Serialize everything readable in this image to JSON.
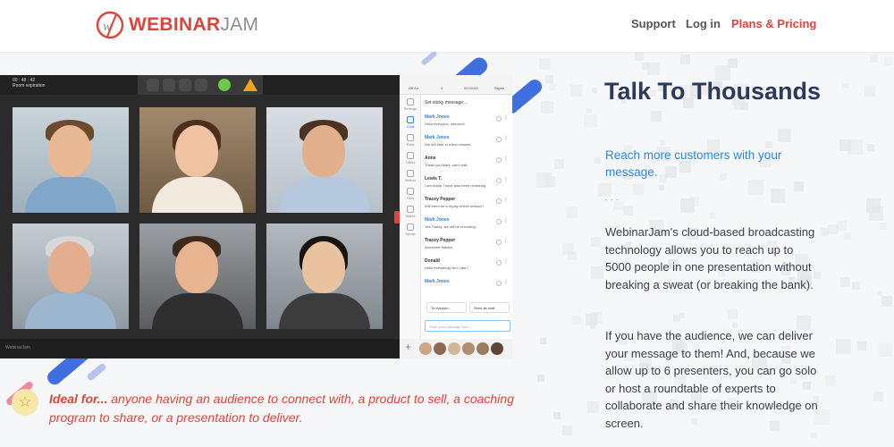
{
  "header": {
    "logo": {
      "text_red": "WEBINAR",
      "text_gray": "JAM",
      "icon": "webinarjam-logo-icon"
    },
    "nav": [
      {
        "label": "Support"
      },
      {
        "label": "Log in"
      },
      {
        "label": "Plans & Pricing"
      }
    ]
  },
  "app": {
    "timer": "00 : 48 : 42",
    "timer_sub": "Room expiration",
    "brand": "WebinarJam",
    "chat_top": [
      "Off Air",
      "0",
      "00:00:00",
      "Signal"
    ],
    "sidebar": [
      "Settings",
      "Chat",
      "Polls",
      "Offers",
      "Videos",
      "Files",
      "Slides",
      "Speak"
    ],
    "sticky": "Set sticky message...",
    "messages": [
      {
        "name": "Mark Jones",
        "text": "Hello everyone, welcome",
        "highlight": true
      },
      {
        "name": "Mark Jones",
        "text": "We will start in a few minutes",
        "highlight": true
      },
      {
        "name": "Anne",
        "text": "Thank you Mark, can't wait",
        "highlight": false
      },
      {
        "name": "Lewis T.",
        "text": "I am ready. I have also been reviewing",
        "highlight": false
      },
      {
        "name": "Tracey Pepper",
        "text": "Will there be a replay of this session?",
        "highlight": false
      },
      {
        "name": "Mark Jones",
        "text": "Yes Tracey, we will be recording",
        "highlight": true
      },
      {
        "name": "Tracey Pepper",
        "text": "Awesome thanks!",
        "highlight": false
      },
      {
        "name": "Donald",
        "text": "Hello everybody! Am I late?",
        "highlight": false
      },
      {
        "name": "Mark Jones",
        "text": "",
        "highlight": true
      }
    ],
    "to_everybody": "To everybo...",
    "send_as_chat": "Send as chat",
    "input_placeholder": "Write your message here..."
  },
  "ideal": {
    "lead": "Ideal for...",
    "text": " anyone having an audience to connect with, a product to sell, a coaching program to share, or a presentation to deliver."
  },
  "copy": {
    "title": "Talk To Thousands",
    "subtitle": "Reach more customers with your message.",
    "separator": "- - -",
    "p1": "WebinarJam's cloud-based broadcasting technology allows you to reach up to 5000 people in one presentation without breaking a sweat (or breaking the bank).",
    "p2": "If you have the audience, we can deliver your message to them! And, because we allow up to 6 presenters, you can go solo or host a roundtable of experts to collaborate and share their knowledge on screen."
  },
  "colors": {
    "brand_red": "#d9453d",
    "title_navy": "#2c3a59",
    "link_blue": "#2f86d6"
  }
}
